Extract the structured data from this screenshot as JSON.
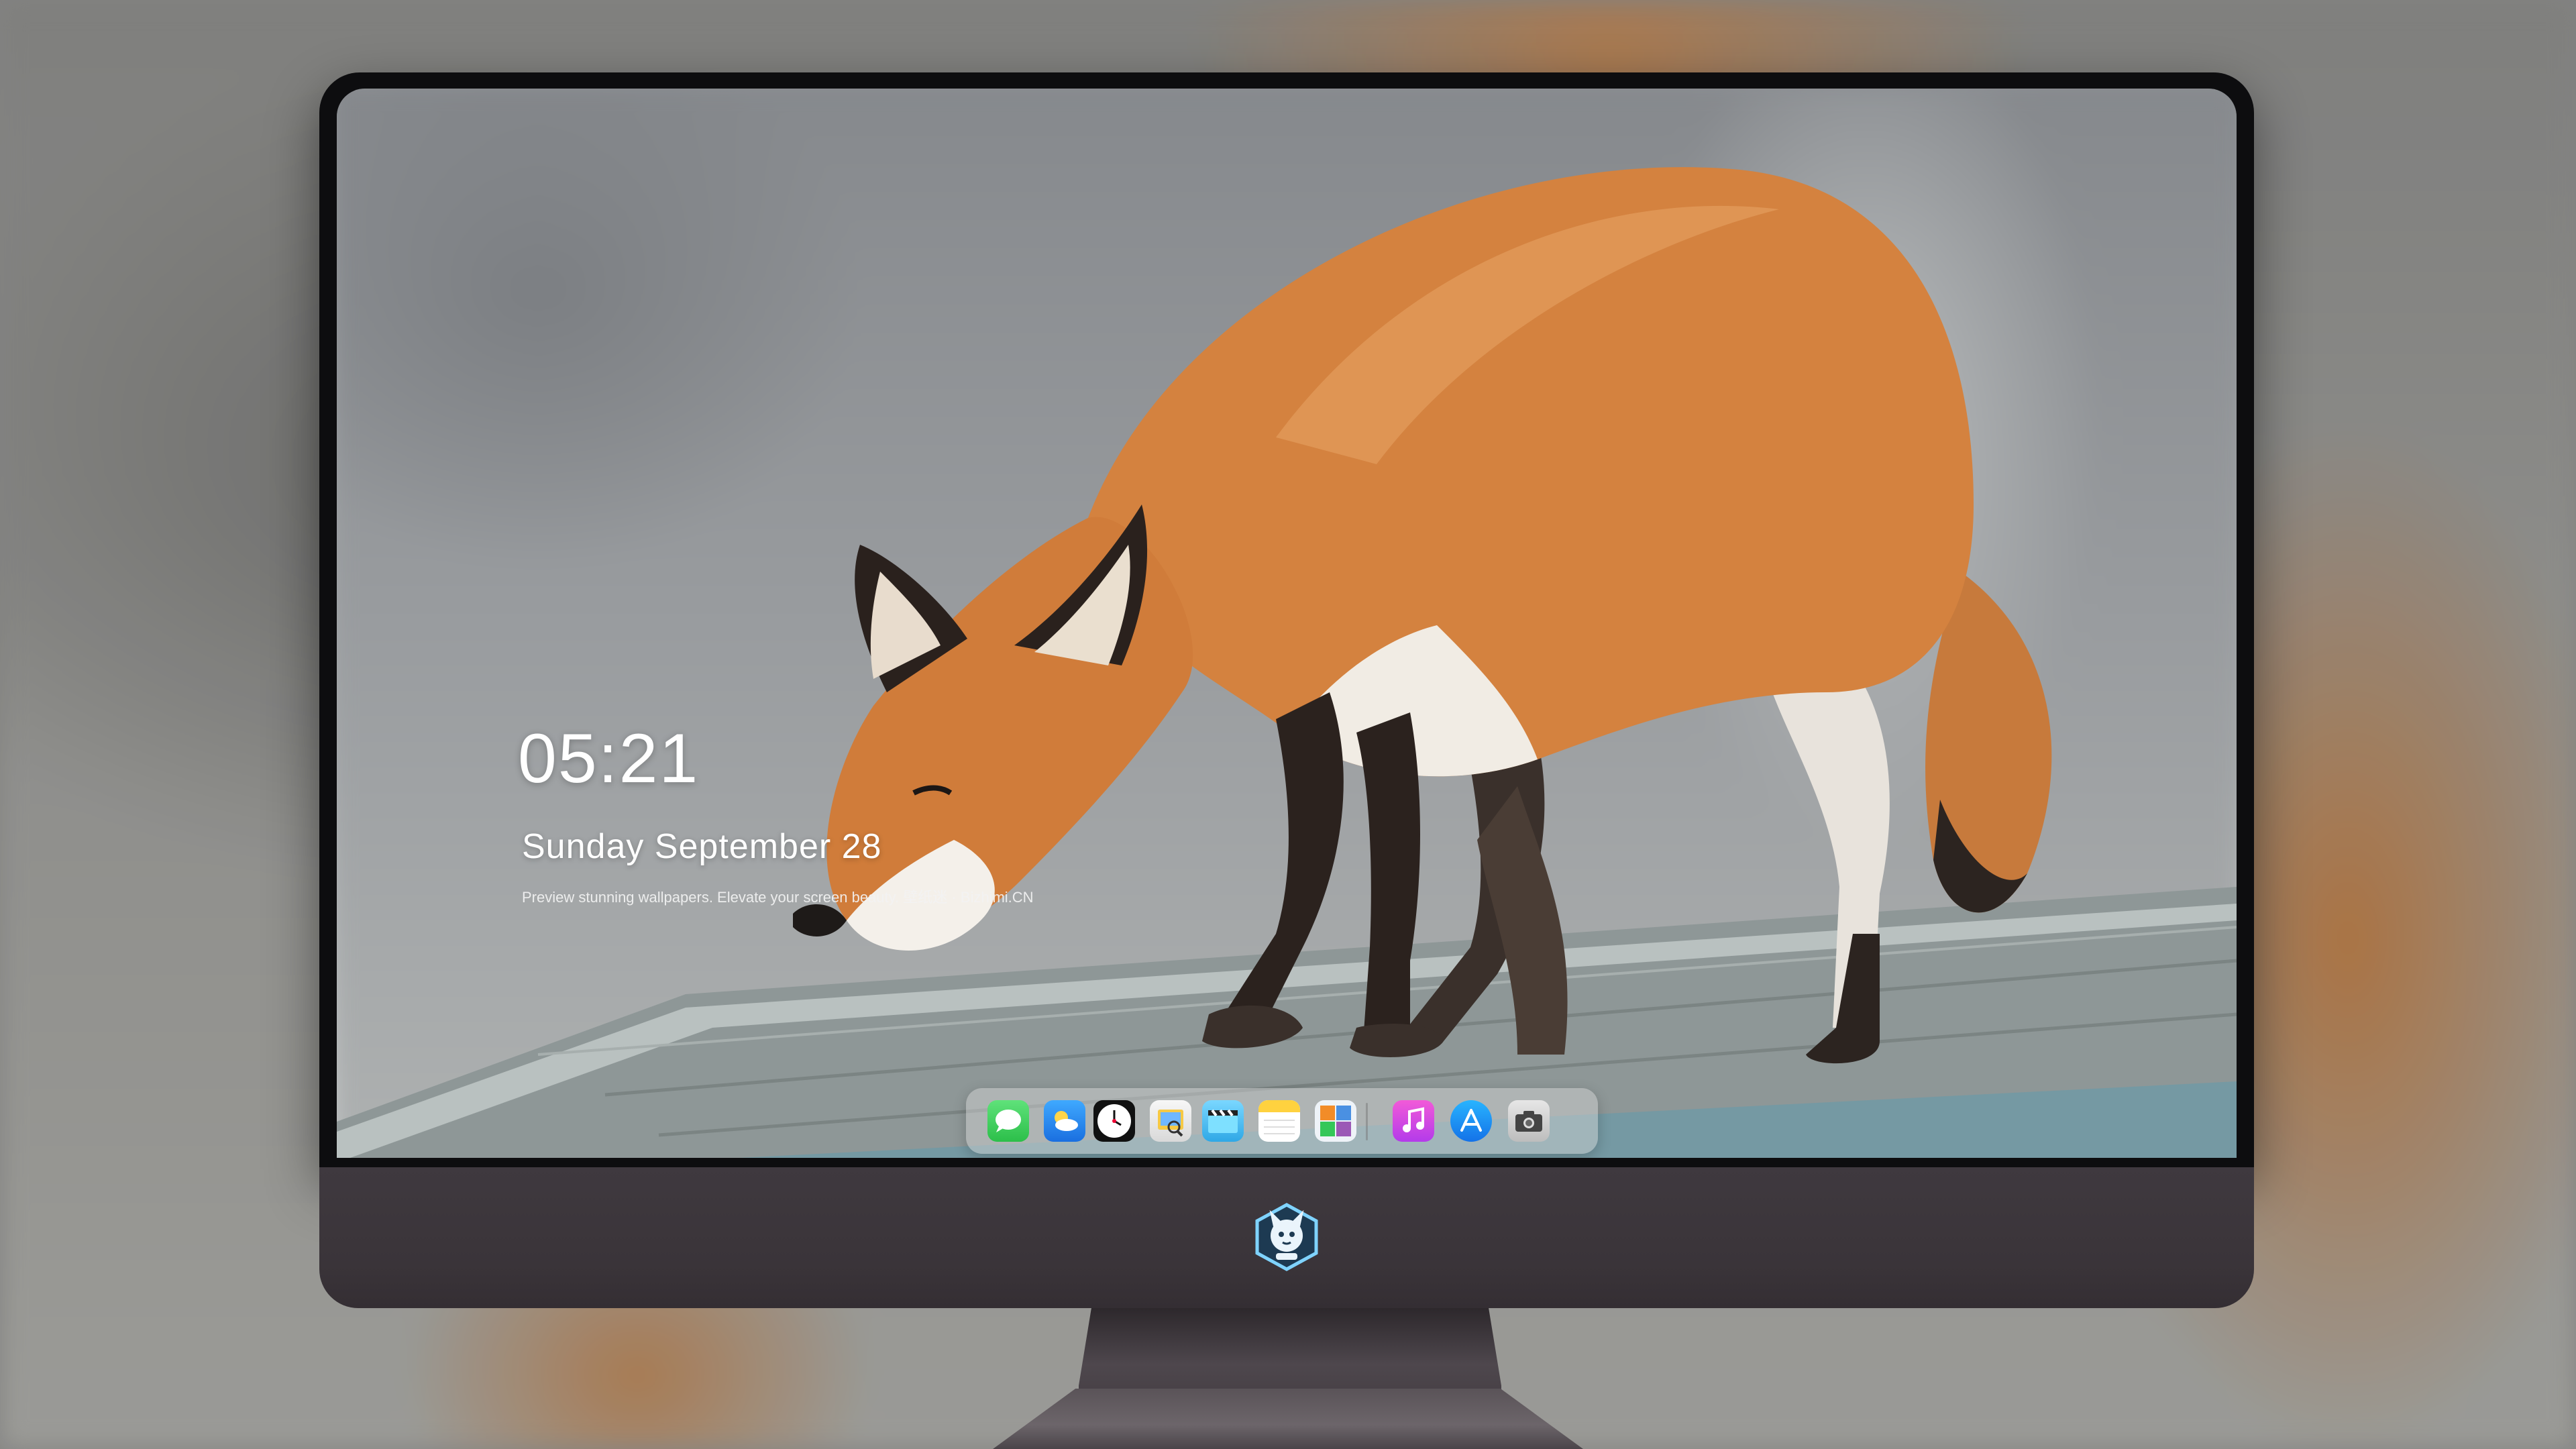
{
  "lock_screen": {
    "time": "05:21",
    "date": "Sunday September  28",
    "tagline": "Preview stunning wallpapers. Elevate your screen beauty. 壁纸迷 · Bizhimi.CN"
  },
  "dock": {
    "apps": [
      {
        "name": "messages-icon",
        "color": "#35c759"
      },
      {
        "name": "weather-icon",
        "color": "#1e90ff"
      },
      {
        "name": "clock-icon",
        "color": "#111111"
      },
      {
        "name": "preview-icon",
        "color": "#f2c94c"
      },
      {
        "name": "clips-icon",
        "color": "#5ac8fa"
      },
      {
        "name": "notes-icon",
        "color": "#ffd60a"
      },
      {
        "name": "photo-collage-icon",
        "color": "#4a90e2"
      },
      {
        "name": "music-icon",
        "color": "#e84bdc"
      },
      {
        "name": "app-store-icon",
        "color": "#1a8cff"
      },
      {
        "name": "camera-icon",
        "color": "#5c5c5c"
      }
    ]
  }
}
